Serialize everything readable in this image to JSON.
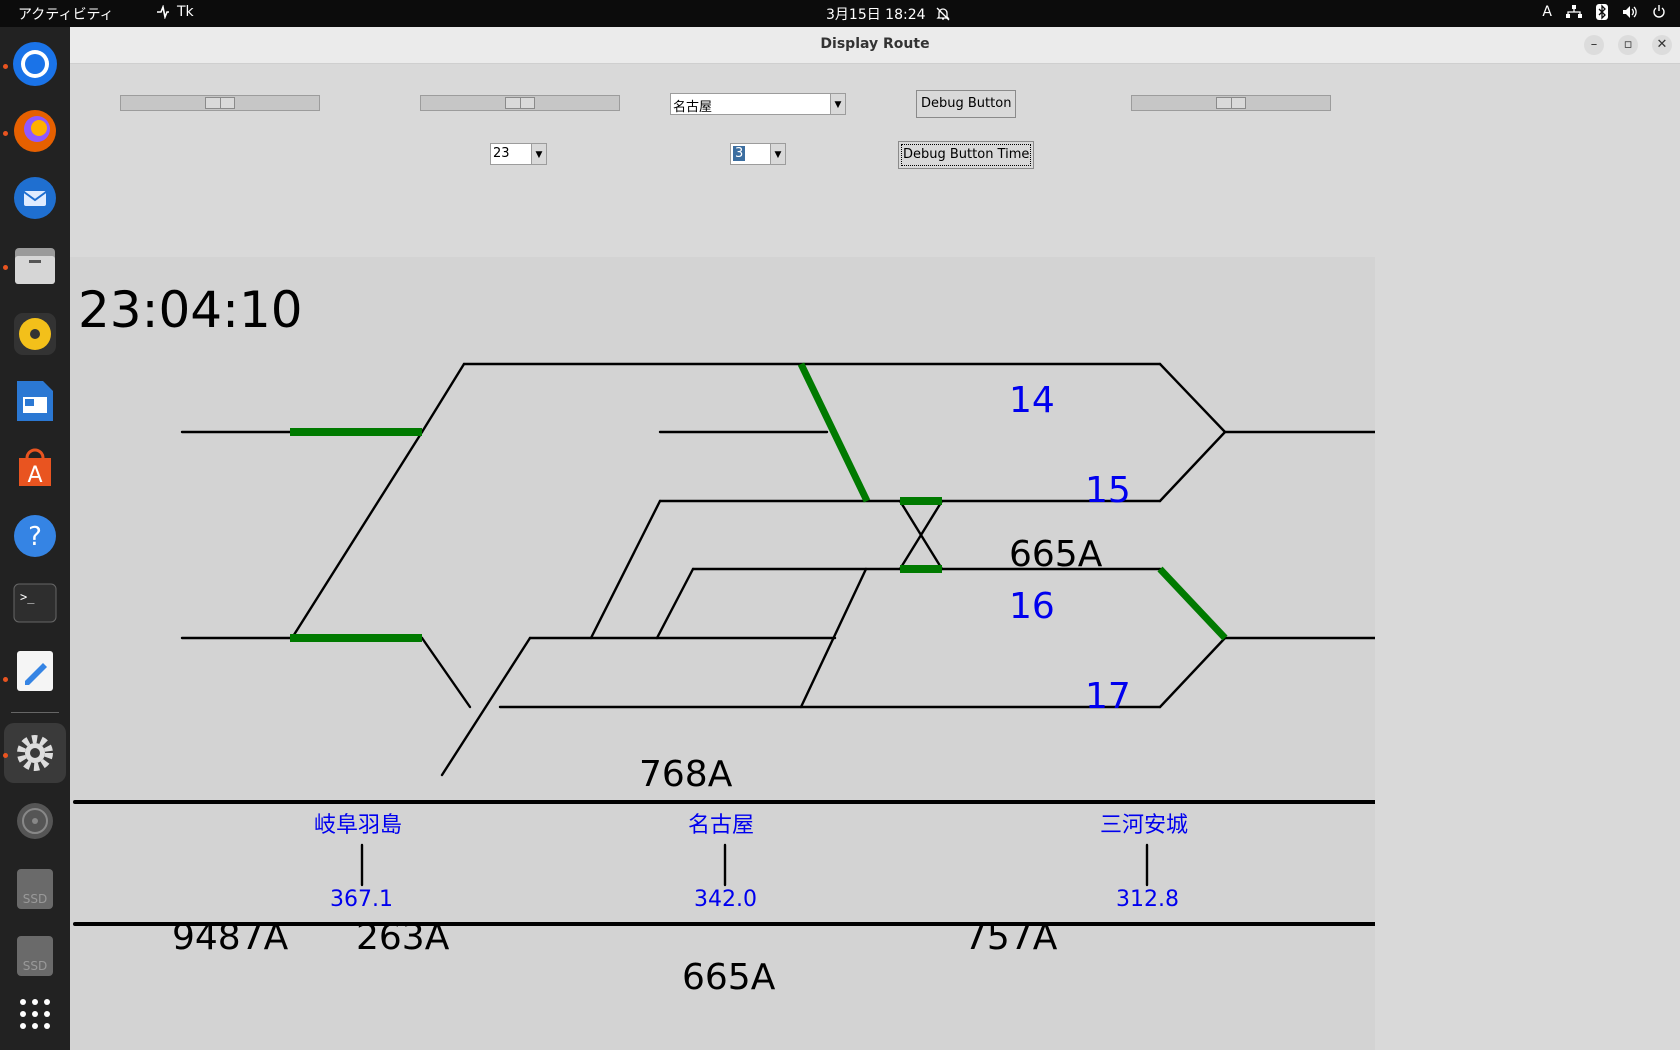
{
  "topbar": {
    "activities": "アクティビティ",
    "app_name": "Tk",
    "datetime": "3月15日  18:24",
    "input_method": "A"
  },
  "window": {
    "title": "Display Route"
  },
  "controls": {
    "slider1_value": 0.5,
    "slider2_value": 0.5,
    "slider3_value": 0.5,
    "station_select": "名古屋",
    "hour_select": "23",
    "minute_select": "3",
    "debug_button": "Debug Button",
    "debug_time_button": "Debug Button Time"
  },
  "display": {
    "time": "23:04:10",
    "tracks": [
      "14",
      "15",
      "16",
      "17"
    ],
    "trains_yard": [
      "665A",
      "768A"
    ],
    "stations": [
      {
        "name": "岐阜羽島",
        "km": "367.1"
      },
      {
        "name": "名古屋",
        "km": "342.0"
      },
      {
        "name": "三河安城",
        "km": "312.8"
      }
    ],
    "trains_line": [
      "9487A",
      "263A",
      "757A",
      "665A"
    ]
  },
  "colors": {
    "route": "#007a00",
    "track_label": "#0000ee"
  }
}
